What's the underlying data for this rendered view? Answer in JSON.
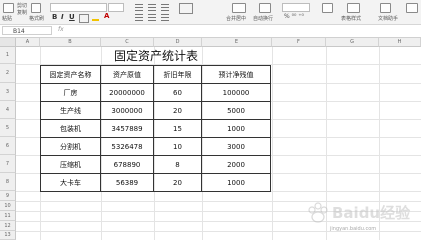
{
  "ribbon": {
    "paste_label": "粘贴",
    "cut_label": "剪切",
    "copy_label": "复制",
    "format_painter_label": "格式刷",
    "bold": "B",
    "italic": "I",
    "underline": "U",
    "font_color_glyph": "A",
    "merge_label": "合并居中",
    "wrap_label": "自动换行",
    "table_style_label": "表格样式",
    "doc_assist_label": "文档助手"
  },
  "formula_bar": {
    "name_box": "B14",
    "fx": "fx"
  },
  "columns": [
    "A",
    "B",
    "C",
    "D",
    "E",
    "F",
    "G",
    "H"
  ],
  "rows": [
    "1",
    "2",
    "3",
    "4",
    "5",
    "6",
    "7",
    "8",
    "9",
    "10",
    "11",
    "12",
    "13",
    "14",
    "15",
    "16",
    "17",
    "18",
    "19"
  ],
  "sheet": {
    "title": "固定资产统计表",
    "headers": [
      "固定资产名称",
      "资产原值",
      "折旧年限",
      "预计净残值"
    ],
    "data": [
      [
        "厂房",
        "20000000",
        "60",
        "100000"
      ],
      [
        "生产线",
        "3000000",
        "20",
        "5000"
      ],
      [
        "包装机",
        "3457889",
        "15",
        "1000"
      ],
      [
        "分割机",
        "5326478",
        "10",
        "3000"
      ],
      [
        "压缩机",
        "678890",
        "8",
        "2000"
      ],
      [
        "大卡车",
        "56389",
        "20",
        "1000"
      ]
    ]
  },
  "watermark": {
    "brand": "Baidu经验",
    "url": "jingyan.baidu.com"
  }
}
